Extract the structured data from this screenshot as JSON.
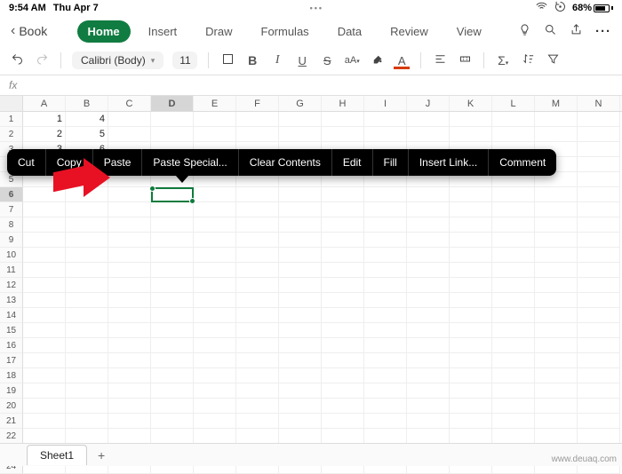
{
  "status": {
    "time": "9:54 AM",
    "date": "Thu Apr 7",
    "battery": "68%"
  },
  "doc": {
    "name": "Book"
  },
  "tabs": [
    "Home",
    "Insert",
    "Draw",
    "Formulas",
    "Data",
    "Review",
    "View"
  ],
  "active_tab": "Home",
  "font": {
    "name": "Calibri (Body)",
    "size": "11"
  },
  "fx_label": "fx",
  "columns": [
    "A",
    "B",
    "C",
    "D",
    "E",
    "F",
    "G",
    "H",
    "I",
    "J",
    "K",
    "L",
    "M",
    "N"
  ],
  "selected_col": "D",
  "rows": 24,
  "selected_row": 6,
  "cells": {
    "A1": "1",
    "B1": "4",
    "A2": "2",
    "B2": "5",
    "A3": "3",
    "B3": "6"
  },
  "context_menu": [
    "Cut",
    "Copy",
    "Paste",
    "Paste Special...",
    "Clear Contents",
    "Edit",
    "Fill",
    "Insert Link...",
    "Comment"
  ],
  "sheet": {
    "name": "Sheet1"
  },
  "watermark": "www.deuaq.com",
  "colors": {
    "accent": "#107c41"
  }
}
